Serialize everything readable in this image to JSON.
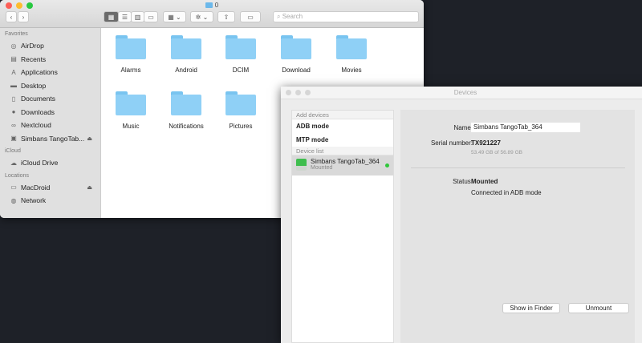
{
  "finder": {
    "title": "0",
    "search_placeholder": "Search",
    "sidebar": {
      "favorites_label": "Favorites",
      "favorites": [
        {
          "label": "AirDrop",
          "icon": "airdrop-icon"
        },
        {
          "label": "Recents",
          "icon": "recents-icon"
        },
        {
          "label": "Applications",
          "icon": "applications-icon"
        },
        {
          "label": "Desktop",
          "icon": "desktop-icon"
        },
        {
          "label": "Documents",
          "icon": "documents-icon"
        },
        {
          "label": "Downloads",
          "icon": "downloads-icon"
        },
        {
          "label": "Nextcloud",
          "icon": "nextcloud-icon"
        },
        {
          "label": "Simbans TangoTab...",
          "icon": "device-icon"
        }
      ],
      "icloud_label": "iCloud",
      "icloud": [
        {
          "label": "iCloud Drive"
        }
      ],
      "locations_label": "Locations",
      "locations": [
        {
          "label": "MacDroid"
        },
        {
          "label": "Network"
        }
      ]
    },
    "folders": [
      "Alarms",
      "Android",
      "DCIM",
      "Download",
      "Movies",
      "Music",
      "Notifications",
      "Pictures"
    ]
  },
  "devices": {
    "title": "Devices",
    "add_devices": "Add devices",
    "adb": "ADB mode",
    "mtp": "MTP mode",
    "device_list": "Device list",
    "device": {
      "name": "Simbans TangoTab_364",
      "status": "Mounted"
    },
    "detail": {
      "name_label": "Name:",
      "name_value": "Simbans TangoTab_364",
      "serial_label": "Serial number:",
      "serial_value": "TX921227",
      "storage": "53.49 GB of 56.89 GB",
      "status_label": "Status:",
      "status_value": "Mounted",
      "status_detail": "Connected in ADB mode"
    },
    "show_in_finder": "Show in Finder",
    "unmount": "Unmount"
  }
}
